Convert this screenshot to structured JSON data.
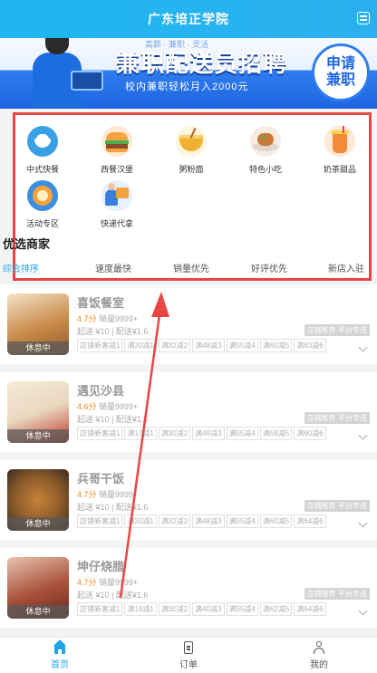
{
  "header": {
    "title": "广东培正学院"
  },
  "banner": {
    "hint": "高薪 · 兼职 · 灵活",
    "title": "兼职配送员招聘",
    "subtitle": "校内兼职轻松月入2000元",
    "badge_line1": "申请",
    "badge_line2": "兼职"
  },
  "categories": [
    {
      "label": "中式快餐",
      "icon": "rice-bowl-icon",
      "color": "#3aa0e6"
    },
    {
      "label": "西餐汉堡",
      "icon": "burger-icon",
      "color": "#f4a340"
    },
    {
      "label": "粥粉面",
      "icon": "noodle-bowl-icon",
      "color": "#f0b030"
    },
    {
      "label": "特色小吃",
      "icon": "snack-plate-icon",
      "color": "#c87a3a"
    },
    {
      "label": "奶茶甜品",
      "icon": "milk-tea-icon",
      "color": "#f28a3a"
    },
    {
      "label": "活动专区",
      "icon": "activity-icon",
      "color": "#3a8fe0"
    },
    {
      "label": "快递代拿",
      "icon": "delivery-icon",
      "color": "#3a7fe0"
    }
  ],
  "section_title": "优选商家",
  "sort_options": [
    "综合排序",
    "速度最快",
    "销量优先",
    "好评优先",
    "新店入驻"
  ],
  "shops": [
    {
      "name": "喜饭餐室",
      "score": "4.7分",
      "sales": "销量9999+",
      "min_order": "起送 ¥10",
      "delivery_fee": "配送¥1.6",
      "status": "休息中",
      "tag": "店铺推荐 平台专送",
      "promos": [
        "店铺新客减1",
        "满20减1",
        "满32减2",
        "满48减3",
        "满55减4",
        "满60减5",
        "满63减6"
      ],
      "thumb_color": "#c98b4a"
    },
    {
      "name": "遇见沙县",
      "score": "4.6分",
      "sales": "销量9999+",
      "min_order": "起送 ¥10",
      "delivery_fee": "配送¥1.6",
      "status": "休息中",
      "tag": "店铺推荐 平台专送",
      "promos": [
        "店铺新客减1",
        "满17减1",
        "满30减2",
        "满49减3",
        "满55减4",
        "满58减5",
        "满60减6"
      ],
      "thumb_color": "#e9d8c0"
    },
    {
      "name": "兵哥干饭",
      "score": "4.7分",
      "sales": "销量9999+",
      "min_order": "起送 ¥10",
      "delivery_fee": "配送¥1.6",
      "status": "休息中",
      "tag": "店铺推荐 平台专送",
      "promos": [
        "店铺新客减1",
        "满20减1",
        "满32减2",
        "满48减3",
        "满55减4",
        "满60减5",
        "满64减6"
      ],
      "thumb_color": "#8a5a2a"
    },
    {
      "name": "坤仔烧腊",
      "score": "4.7分",
      "sales": "销量9999+",
      "min_order": "起送 ¥10",
      "delivery_fee": "配送¥1.6",
      "status": "休息中",
      "tag": "店铺推荐 平台专送",
      "promos": [
        "店铺新客减1",
        "满19减1",
        "满30减2",
        "满40减3",
        "满55减4",
        "满62减5",
        "满64减6"
      ],
      "thumb_color": "#a8503a"
    }
  ],
  "tabs": [
    {
      "label": "首页",
      "icon": "home-icon"
    },
    {
      "label": "订单",
      "icon": "order-icon"
    },
    {
      "label": "我的",
      "icon": "profile-icon"
    }
  ],
  "colors": {
    "accent": "#1fa6e8",
    "annotation": "#e84545",
    "score": "#f08a1c"
  }
}
